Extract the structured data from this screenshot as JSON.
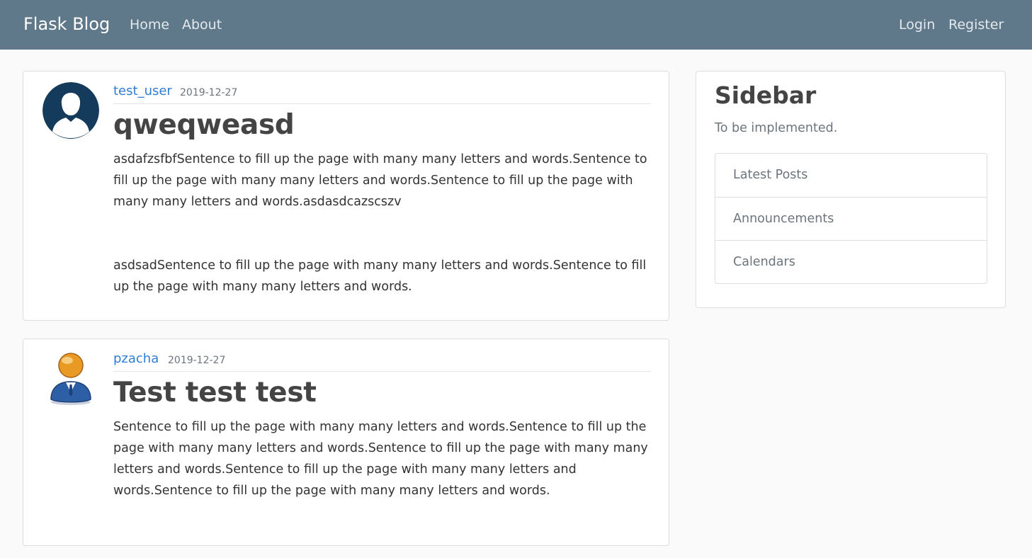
{
  "navbar": {
    "brand": "Flask Blog",
    "left_links": [
      "Home",
      "About"
    ],
    "right_links": [
      "Login",
      "Register"
    ],
    "background_color": "#5f788a"
  },
  "posts": [
    {
      "avatar_icon": "user-silhouette-icon",
      "author": "test_user",
      "date": "2019-12-27",
      "title": "qweqweasd",
      "paragraphs": [
        "asdafzsfbfSentence to fill up the page with many many letters and words.Sentence to fill up the page with many many letters and words.Sentence to fill up the page with many many letters and words.asdasdcazscszv",
        "asdsadSentence to fill up the page with many many letters and words.Sentence to fill up the page with many many letters and words."
      ]
    },
    {
      "avatar_icon": "user-person-icon",
      "author": "pzacha",
      "date": "2019-12-27",
      "title": "Test test test",
      "paragraphs": [
        "Sentence to fill up the page with many many letters and words.Sentence to fill up the page with many many letters and words.Sentence to fill up the page with many many letters and words.Sentence to fill up the page with many many letters and words.Sentence to fill up the page with many many letters and words."
      ]
    }
  ],
  "sidebar": {
    "title": "Sidebar",
    "subtitle": "To be implemented.",
    "items": [
      "Latest Posts",
      "Announcements",
      "Calendars"
    ]
  },
  "colors": {
    "link": "#2f7dd6",
    "muted": "#6c757d",
    "page_background": "#fafafa",
    "card_border": "#dddddd"
  }
}
